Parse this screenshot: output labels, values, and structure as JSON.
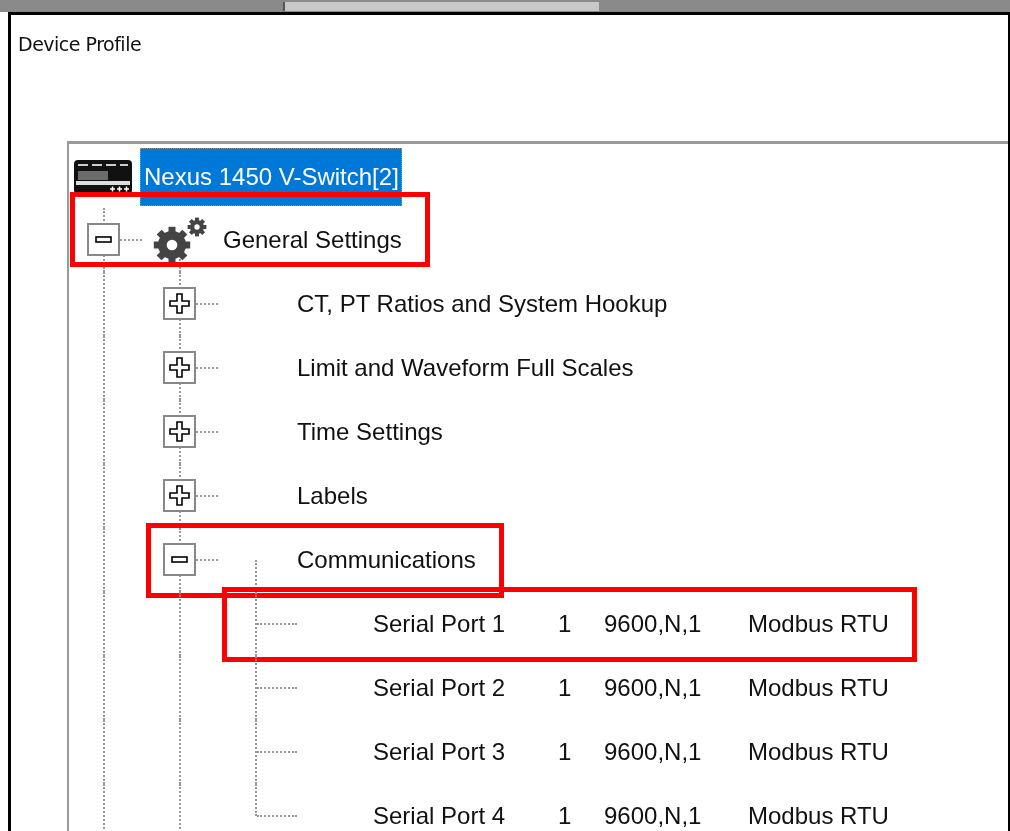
{
  "panel": {
    "title": "Device Profile"
  },
  "tree": {
    "kind": "device",
    "label": "Nexus 1450 V-Switch[2]",
    "selected": true,
    "children": [
      {
        "kind": "section",
        "label": "General Settings",
        "selected": false,
        "expanded": true,
        "highlighted": true,
        "children": [
          {
            "label": "CT, PT Ratios and System Hookup",
            "selected": false,
            "expanded": false,
            "highlighted": false
          },
          {
            "label": "Limit and Waveform Full Scales",
            "selected": false,
            "expanded": false,
            "highlighted": false
          },
          {
            "label": "Time Settings",
            "selected": false,
            "expanded": false,
            "highlighted": false
          },
          {
            "label": "Labels",
            "selected": false,
            "expanded": false,
            "highlighted": false
          },
          {
            "label": "Communications",
            "selected": false,
            "expanded": true,
            "highlighted": true,
            "children": [
              {
                "kind": "port",
                "name": "Serial Port 1",
                "address": "1",
                "settings": "9600,N,1",
                "protocol": "Modbus RTU",
                "selected": false,
                "highlighted": true
              },
              {
                "kind": "port",
                "name": "Serial Port 2",
                "address": "1",
                "settings": "9600,N,1",
                "protocol": "Modbus RTU",
                "selected": false,
                "highlighted": false
              },
              {
                "kind": "port",
                "name": "Serial Port 3",
                "address": "1",
                "settings": "9600,N,1",
                "protocol": "Modbus RTU",
                "selected": false,
                "highlighted": false
              },
              {
                "kind": "port",
                "name": "Serial Port 4",
                "address": "1",
                "settings": "9600,N,1",
                "protocol": "Modbus RTU",
                "selected": false,
                "highlighted": false
              }
            ]
          }
        ]
      }
    ]
  }
}
